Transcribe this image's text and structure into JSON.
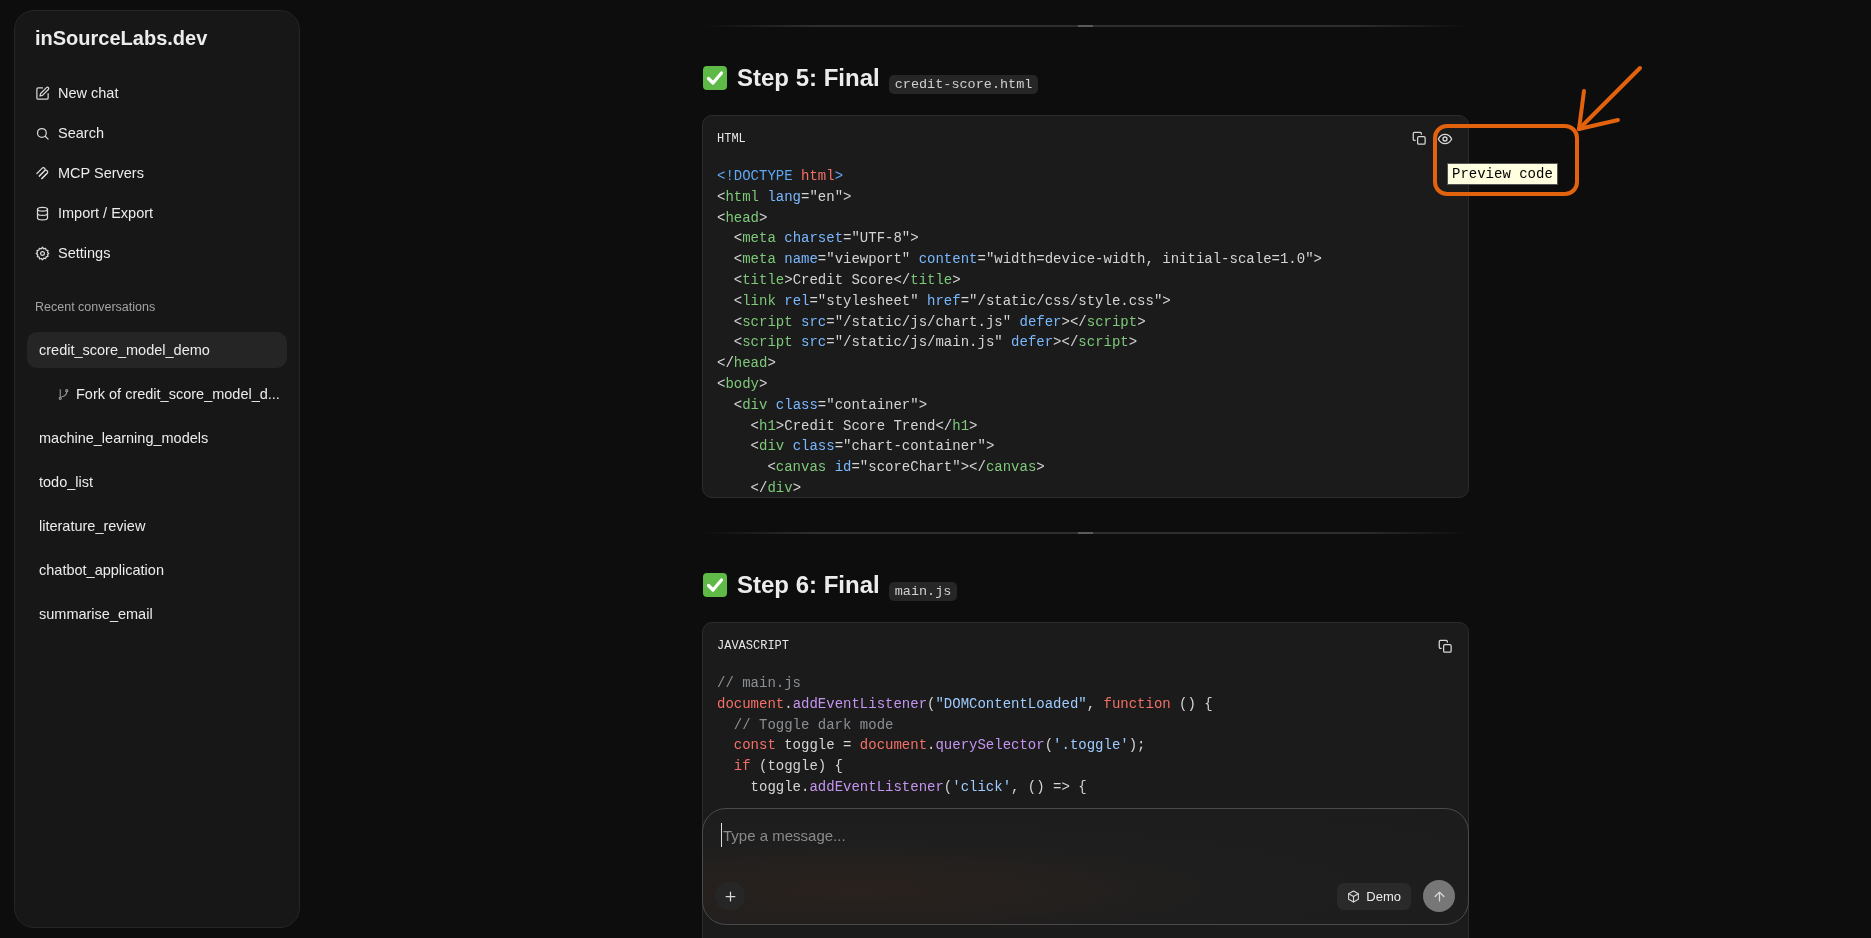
{
  "sidebar": {
    "brand": "inSourceLabs.dev",
    "nav": [
      {
        "label": "New chat"
      },
      {
        "label": "Search"
      },
      {
        "label": "MCP Servers"
      },
      {
        "label": "Import / Export"
      },
      {
        "label": "Settings"
      }
    ],
    "section_label": "Recent conversations",
    "conversations": [
      {
        "label": "credit_score_model_demo",
        "selected": true,
        "children": [
          {
            "label": "Fork of credit_score_model_d...",
            "selected": false
          }
        ]
      },
      {
        "label": "machine_learning_models",
        "selected": false
      },
      {
        "label": "todo_list",
        "selected": false
      },
      {
        "label": "literature_review",
        "selected": false
      },
      {
        "label": "chatbot_application",
        "selected": false
      },
      {
        "label": "summarise_email",
        "selected": false
      }
    ]
  },
  "sections": [
    {
      "heading": "Step 5: Final",
      "file": "credit-score.html",
      "code_block": {
        "language": "HTML",
        "actions": [
          {
            "kind": "copy"
          },
          {
            "kind": "preview"
          }
        ],
        "lines": [
          [
            {
              "kind": "doctype",
              "text": "<!DOCTYPE"
            },
            {
              "kind": "keyword",
              "text": " html"
            },
            {
              "kind": "doctype",
              "text": ">"
            }
          ],
          [
            {
              "kind": "plain",
              "text": "<"
            },
            {
              "kind": "tag",
              "text": "html"
            },
            {
              "kind": "attr",
              "text": " lang"
            },
            {
              "kind": "plain",
              "text": "=\"en\">"
            }
          ],
          [
            {
              "kind": "plain",
              "text": "<"
            },
            {
              "kind": "tag",
              "text": "head"
            },
            {
              "kind": "plain",
              "text": ">"
            }
          ],
          [
            {
              "kind": "plain",
              "text": "  <"
            },
            {
              "kind": "tag",
              "text": "meta"
            },
            {
              "kind": "attr",
              "text": " charset"
            },
            {
              "kind": "plain",
              "text": "=\"UTF-8\">"
            }
          ],
          [
            {
              "kind": "plain",
              "text": "  <"
            },
            {
              "kind": "tag",
              "text": "meta"
            },
            {
              "kind": "attr",
              "text": " name"
            },
            {
              "kind": "plain",
              "text": "=\"viewport\""
            },
            {
              "kind": "attr",
              "text": " content"
            },
            {
              "kind": "plain",
              "text": "=\"width=device-width, initial-scale=1.0\">"
            }
          ],
          [
            {
              "kind": "plain",
              "text": "  <"
            },
            {
              "kind": "tag",
              "text": "title"
            },
            {
              "kind": "plain",
              "text": ">Credit Score</"
            },
            {
              "kind": "tag",
              "text": "title"
            },
            {
              "kind": "plain",
              "text": ">"
            }
          ],
          [
            {
              "kind": "plain",
              "text": "  <"
            },
            {
              "kind": "tag",
              "text": "link"
            },
            {
              "kind": "attr",
              "text": " rel"
            },
            {
              "kind": "plain",
              "text": "=\"stylesheet\""
            },
            {
              "kind": "attr",
              "text": " href"
            },
            {
              "kind": "plain",
              "text": "=\"/static/css/style.css\">"
            }
          ],
          [
            {
              "kind": "plain",
              "text": "  <"
            },
            {
              "kind": "tag",
              "text": "script"
            },
            {
              "kind": "attr",
              "text": " src"
            },
            {
              "kind": "plain",
              "text": "=\"/static/js/chart.js\""
            },
            {
              "kind": "attr",
              "text": " defer"
            },
            {
              "kind": "plain",
              "text": "></"
            },
            {
              "kind": "tag",
              "text": "script"
            },
            {
              "kind": "plain",
              "text": ">"
            }
          ],
          [
            {
              "kind": "plain",
              "text": "  <"
            },
            {
              "kind": "tag",
              "text": "script"
            },
            {
              "kind": "attr",
              "text": " src"
            },
            {
              "kind": "plain",
              "text": "=\"/static/js/main.js\""
            },
            {
              "kind": "attr",
              "text": " defer"
            },
            {
              "kind": "plain",
              "text": "></"
            },
            {
              "kind": "tag",
              "text": "script"
            },
            {
              "kind": "plain",
              "text": ">"
            }
          ],
          [
            {
              "kind": "plain",
              "text": "</"
            },
            {
              "kind": "tag",
              "text": "head"
            },
            {
              "kind": "plain",
              "text": ">"
            }
          ],
          [
            {
              "kind": "plain",
              "text": "<"
            },
            {
              "kind": "tag",
              "text": "body"
            },
            {
              "kind": "plain",
              "text": ">"
            }
          ],
          [
            {
              "kind": "plain",
              "text": "  <"
            },
            {
              "kind": "tag",
              "text": "div"
            },
            {
              "kind": "attr",
              "text": " class"
            },
            {
              "kind": "plain",
              "text": "=\"container\">"
            }
          ],
          [
            {
              "kind": "plain",
              "text": "    <"
            },
            {
              "kind": "tag",
              "text": "h1"
            },
            {
              "kind": "plain",
              "text": ">Credit Score Trend</"
            },
            {
              "kind": "tag",
              "text": "h1"
            },
            {
              "kind": "plain",
              "text": ">"
            }
          ],
          [
            {
              "kind": "plain",
              "text": "    <"
            },
            {
              "kind": "tag",
              "text": "div"
            },
            {
              "kind": "attr",
              "text": " class"
            },
            {
              "kind": "plain",
              "text": "=\"chart-container\">"
            }
          ],
          [
            {
              "kind": "plain",
              "text": "      <"
            },
            {
              "kind": "tag",
              "text": "canvas"
            },
            {
              "kind": "attr",
              "text": " id"
            },
            {
              "kind": "plain",
              "text": "=\"scoreChart\"></"
            },
            {
              "kind": "tag",
              "text": "canvas"
            },
            {
              "kind": "plain",
              "text": ">"
            }
          ],
          [
            {
              "kind": "plain",
              "text": "    </"
            },
            {
              "kind": "tag",
              "text": "div"
            },
            {
              "kind": "plain",
              "text": ">"
            }
          ]
        ]
      }
    },
    {
      "heading": "Step 6: Final",
      "file": "main.js",
      "code_block": {
        "language": "JAVASCRIPT",
        "actions": [
          {
            "kind": "copy"
          }
        ],
        "lines": [
          [
            {
              "kind": "comment",
              "text": "// main.js"
            }
          ],
          [
            {
              "kind": "keyword",
              "text": "document"
            },
            {
              "kind": "plain",
              "text": "."
            },
            {
              "kind": "func",
              "text": "addEventListener"
            },
            {
              "kind": "plain",
              "text": "("
            },
            {
              "kind": "string",
              "text": "\"DOMContentLoaded\""
            },
            {
              "kind": "plain",
              "text": ", "
            },
            {
              "kind": "keyword",
              "text": "function"
            },
            {
              "kind": "plain",
              "text": " () {"
            }
          ],
          [
            {
              "kind": "comment",
              "text": "  // Toggle dark mode"
            }
          ],
          [
            {
              "kind": "keyword",
              "text": "  const"
            },
            {
              "kind": "plain",
              "text": " toggle = "
            },
            {
              "kind": "keyword",
              "text": "document"
            },
            {
              "kind": "plain",
              "text": "."
            },
            {
              "kind": "func",
              "text": "querySelector"
            },
            {
              "kind": "plain",
              "text": "("
            },
            {
              "kind": "string",
              "text": "'.toggle'"
            },
            {
              "kind": "plain",
              "text": ");"
            }
          ],
          [
            {
              "kind": "keyword",
              "text": "  if"
            },
            {
              "kind": "plain",
              "text": " (toggle) {"
            }
          ],
          [
            {
              "kind": "plain",
              "text": "    toggle."
            },
            {
              "kind": "func",
              "text": "addEventListener"
            },
            {
              "kind": "plain",
              "text": "("
            },
            {
              "kind": "string",
              "text": "'click'"
            },
            {
              "kind": "plain",
              "text": ", () => {"
            }
          ]
        ]
      }
    }
  ],
  "tooltip": "Preview code",
  "composer": {
    "placeholder": "Type a message...",
    "mode_label": "Demo"
  }
}
